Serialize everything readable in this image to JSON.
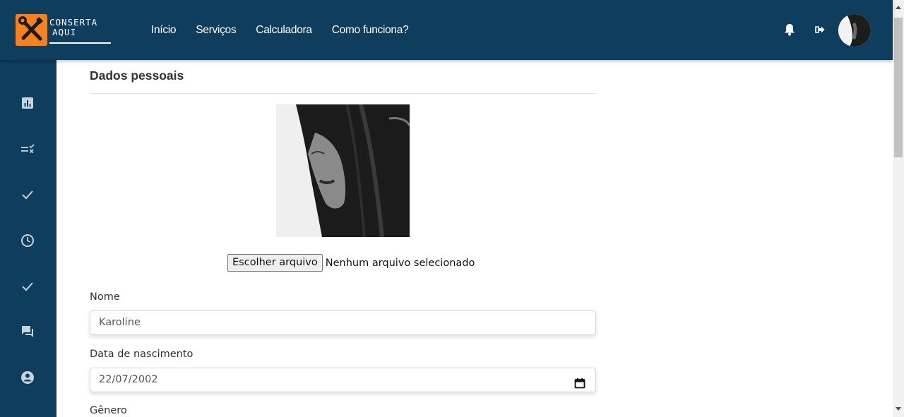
{
  "brand": {
    "line1": "CONSERTA",
    "line2": "AQUI",
    "accent_color": "#f58220",
    "bar_color": "#0e3d5e"
  },
  "nav": {
    "items": [
      {
        "label": "Início"
      },
      {
        "label": "Serviços"
      },
      {
        "label": "Calculadora"
      },
      {
        "label": "Como funciona?"
      }
    ]
  },
  "header_icons": [
    "bell-icon",
    "logout-icon",
    "user-avatar"
  ],
  "sidebar": {
    "items": [
      {
        "icon": "dashboard-chart-icon"
      },
      {
        "icon": "task-list-icon"
      },
      {
        "icon": "check-icon"
      },
      {
        "icon": "clock-icon"
      },
      {
        "icon": "check-icon"
      },
      {
        "icon": "chat-icon"
      },
      {
        "icon": "account-icon"
      }
    ]
  },
  "profile": {
    "section_title": "Dados pessoais",
    "file_button": "Escolher arquivo",
    "file_status": "Nenhum arquivo selecionado",
    "name_label": "Nome",
    "name_value": "Karoline",
    "birth_label": "Data de nascimento",
    "birth_value": "22/07/2002",
    "gender_label": "Gênero"
  }
}
